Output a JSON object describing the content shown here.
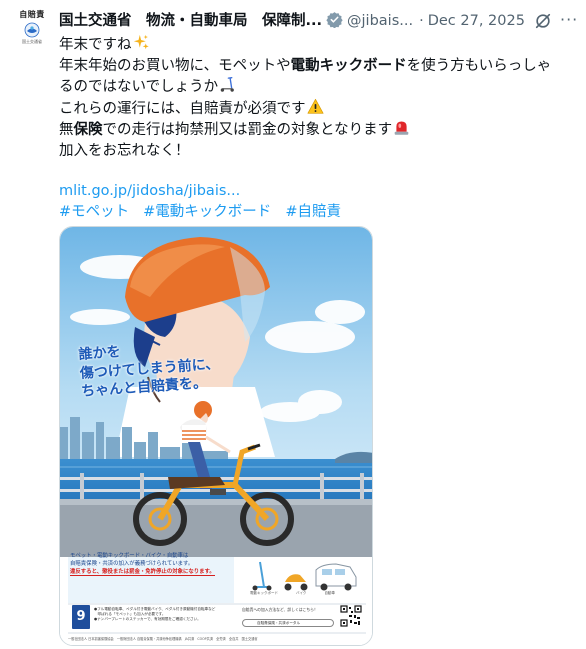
{
  "account": {
    "avatar_label": "自賠責",
    "avatar_sublabel": "国土交通省",
    "name": "国土交通省　物流・自動車局　保障制...",
    "handle": "@jibais...",
    "separator": "·",
    "date": "Dec 27, 2025"
  },
  "tweet": {
    "line1": "年末ですね",
    "line2": "年末年始のお買い物に、モペットや",
    "line2_bold": "電動キックボード",
    "line2_end": "を使う方もいらっしゃ",
    "line3": "るのではないでしょうか",
    "line4": "これらの運行には、自賠責が必須です",
    "line5_start": "無",
    "line5_bold": "保険",
    "line5_end": "での走行は拘禁刑又は罰金の対象となります",
    "line6": "加入をお忘れなく！",
    "link": "mlit.go.jp/jidosha/jibais...",
    "hashtags": [
      "#モペット",
      "#電動キックボード",
      "#自賠責"
    ]
  },
  "poster": {
    "catch_line1": "誰かを",
    "catch_line2": "傷つけてしまう前に、",
    "catch_line3": "ちゃんと自賠責を。",
    "notice_line1": "モペット・電動キックボード・バイク・自動車は",
    "notice_line2": "自賠責保険・共済の加入が義務づけられています。",
    "notice_red": "違反すると、懲役または罰金・免許停止の対象になります。",
    "vehicle_labels": [
      "電動キックボード",
      "バイク",
      "自動車"
    ],
    "badge": "9",
    "footer_line1": "●フル電動自転車、ペダル付き電動バイク、ペダル付き原動機付自転車など",
    "footer_line2": "　呼ばれる「モペット」も加入が必要です。",
    "footer_line3": "●ナンバープレートのステッカーで、有効期限をご確認ください。",
    "info_line": "自賠責への加入方法など、詳しくはこちら！",
    "search_text": "自賠責保険・共済ポータル",
    "sponsors": "一般社団法人 日本損害保険協会　一般財団法人 自賠責保険・共済紛争処理機構　JA共済　COOP共済　全労済　全自共　国土交通省"
  },
  "colors": {
    "link_blue": "#1d9bf0",
    "text_dark": "#0f1419",
    "text_muted": "#536471",
    "poster_blue": "#1e5bb8",
    "warning_red": "#d6201e"
  },
  "icons": [
    "verified-badge-icon",
    "grok-icon",
    "more-icon",
    "sparkles-icon",
    "kick-scooter-icon",
    "warning-icon",
    "police-light-icon"
  ]
}
